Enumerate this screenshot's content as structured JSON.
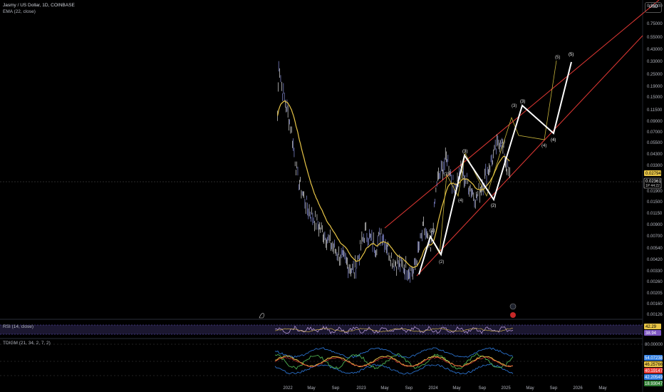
{
  "header": {
    "symbol_title": "Jasmy / US Dollar, 1D, COINBASE",
    "ema_label": "EMA (22, close)",
    "currency_button": "USD"
  },
  "price_axis": {
    "ticks": [
      "0.95000",
      "0.75000",
      "0.55000",
      "0.43000",
      "0.33000",
      "0.25000",
      "0.19000",
      "0.15000",
      "0.11500",
      "0.09000",
      "0.07000",
      "0.05500",
      "0.04300",
      "0.03300",
      "0.01900",
      "0.01500",
      "0.01150",
      "0.00900",
      "0.00700",
      "0.00540",
      "0.00420",
      "0.00330",
      "0.00260",
      "0.00205",
      "0.00160",
      "0.00126"
    ],
    "ema_badge": "0.02794",
    "price_badge": "0.02361",
    "price_badge_sub": "1P 44:22"
  },
  "time_axis": {
    "ticks": [
      "2022",
      "May",
      "Sep",
      "2023",
      "May",
      "Sep",
      "2024",
      "May",
      "Sep",
      "2025",
      "May",
      "Sep",
      "2026",
      "May"
    ]
  },
  "rsi_panel": {
    "label": "RSI (14, close)",
    "value_badges": [
      "42.29",
      "38.94"
    ]
  },
  "tdigm_panel": {
    "label": "TDIGM (21, 34, 2, 7, 2)",
    "axis_top": "80.00000",
    "value_badges": [
      "54.07238",
      "46.25766",
      "40.19147",
      "42.20549",
      "18.93047"
    ]
  },
  "chart_data": {
    "type": "line",
    "scale": "log",
    "price_series_approx": [
      {
        "date": "2021-11-10",
        "close": 0.1
      },
      {
        "date": "2021-11-16",
        "close": 0.34
      },
      {
        "date": "2021-12-01",
        "close": 0.19
      },
      {
        "date": "2022-01-15",
        "close": 0.08
      },
      {
        "date": "2022-02-20",
        "close": 0.025
      },
      {
        "date": "2022-04-10",
        "close": 0.013
      },
      {
        "date": "2022-06-01",
        "close": 0.009
      },
      {
        "date": "2022-09-01",
        "close": 0.005
      },
      {
        "date": "2022-12-01",
        "close": 0.0032
      },
      {
        "date": "2023-01-25",
        "close": 0.0078
      },
      {
        "date": "2023-03-20",
        "close": 0.0055
      },
      {
        "date": "2023-04-15",
        "close": 0.0078
      },
      {
        "date": "2023-06-15",
        "close": 0.004
      },
      {
        "date": "2023-09-25",
        "close": 0.0032
      },
      {
        "date": "2023-11-15",
        "close": 0.0085
      },
      {
        "date": "2023-12-20",
        "close": 0.005
      },
      {
        "date": "2024-01-20",
        "close": 0.023
      },
      {
        "date": "2024-03-12",
        "close": 0.04
      },
      {
        "date": "2024-04-15",
        "close": 0.02
      },
      {
        "date": "2024-05-20",
        "close": 0.03
      },
      {
        "date": "2024-08-05",
        "close": 0.016
      },
      {
        "date": "2024-12-05",
        "close": 0.06
      },
      {
        "date": "2025-01-15",
        "close": 0.028
      },
      {
        "date": "2025-01-25",
        "close": 0.02361
      }
    ],
    "wave_labels": [
      "(1)",
      "(2)",
      "(3)",
      "(4)",
      "(5)"
    ],
    "ema_value": 0.02794,
    "last_price": 0.02361
  }
}
